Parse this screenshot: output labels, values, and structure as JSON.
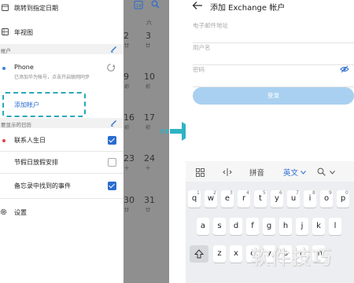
{
  "left_phone": {
    "menu": {
      "goto_date": "跳转到指定日期",
      "year_view": "年视图"
    },
    "accounts": {
      "section_label": "帐户",
      "phone_title": "Phone",
      "phone_desc": "已添加华为帐号，点击开启联网同步",
      "add_account": "添加帐户"
    },
    "calendars": {
      "section_label": "要显示的日历",
      "items": [
        {
          "label": "联系人生日",
          "dot_color": "#e0434b",
          "checked": true
        },
        {
          "label": "节假日放假安排",
          "checked": false
        },
        {
          "label": "备忘录中找到的事件",
          "checked": true
        }
      ]
    },
    "settings": "设置",
    "calendar_strip": {
      "header_day": "六",
      "today_icon": "14",
      "rows": [
        {
          "a": "2",
          "a_sub": "廿",
          "b": "3",
          "b_sub": "廿"
        },
        {
          "a": "9",
          "a_sub": "初",
          "b": "10",
          "b_sub": "初"
        },
        {
          "a": "16",
          "a_sub": "初",
          "b": "17",
          "b_sub": "初"
        },
        {
          "a": "23",
          "a_sub": "十",
          "b": "24",
          "b_sub": "十"
        },
        {
          "a": "30",
          "a_sub": "廿",
          "b": "31",
          "b_sub": "廿"
        }
      ]
    }
  },
  "right_phone": {
    "title": "添加 Exchange 帐户",
    "fields": {
      "email_placeholder": "电子邮件地址",
      "username_placeholder": "用户名",
      "password_placeholder": "密码"
    },
    "login_button": "登录",
    "keyboard": {
      "toolbar": [
        "拼音",
        "英文"
      ],
      "row1": [
        "q",
        "w",
        "e",
        "r",
        "t",
        "y",
        "u",
        "i",
        "o",
        "p"
      ],
      "row1_numbers": [
        "1",
        "2",
        "3",
        "4",
        "5",
        "6",
        "7",
        "8",
        "9",
        "0"
      ],
      "row2": [
        "a",
        "s",
        "d",
        "f",
        "g",
        "h",
        "j",
        "k",
        "l"
      ],
      "row3": [
        "z",
        "x",
        "c",
        "v",
        "b",
        "n",
        "m"
      ]
    }
  },
  "watermark": "软件技巧",
  "colors": {
    "accent_blue": "#2b6ccf",
    "highlight_teal": "#26a9b8",
    "arrow_teal": "#2eb3c4",
    "login_disabled": "#a9d0f0"
  }
}
